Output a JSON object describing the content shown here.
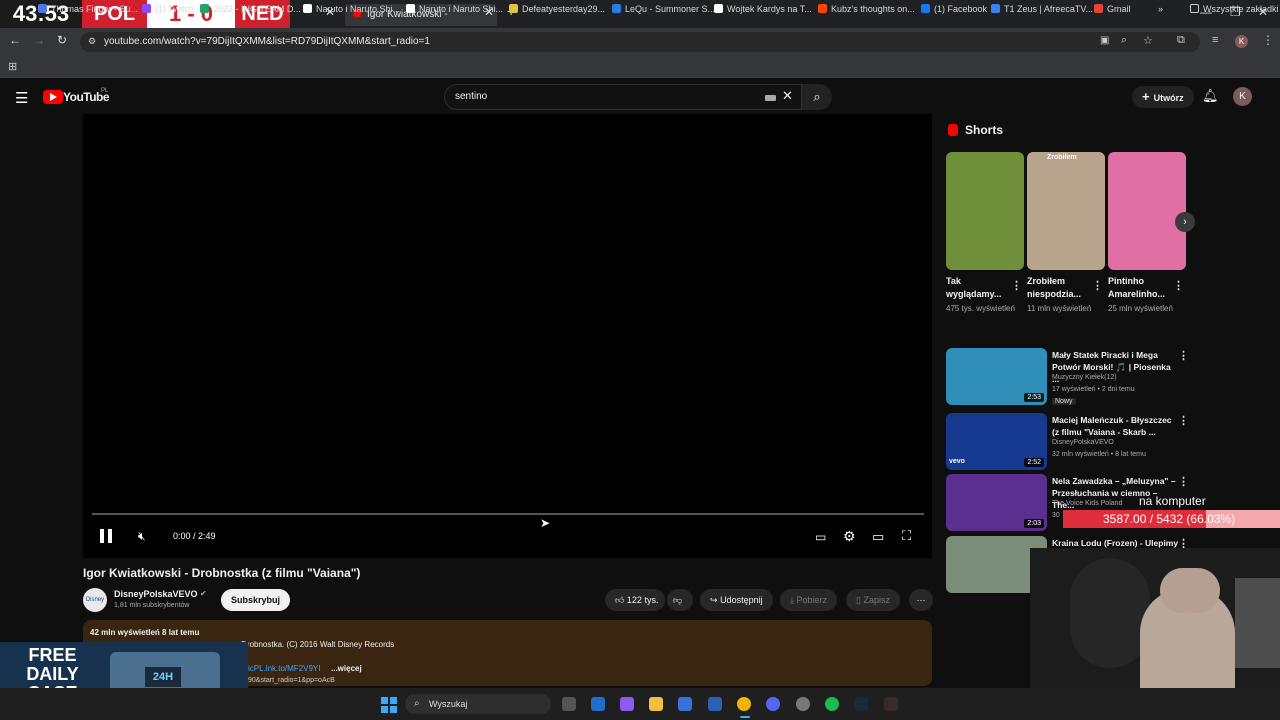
{
  "scoreboard": {
    "time": "43:53",
    "team1": "POL",
    "score": "1 - 0",
    "team2": "NED"
  },
  "tabs": [
    {
      "label": "Igor Kwiatkowski - Drobnostka"
    }
  ],
  "address": {
    "url": "youtube.com/watch?v=79DijItQXMM&list=RD79DijItQXMM&start_radio=1"
  },
  "bookmarks": [
    {
      "label": "Thomas Finger - Su...",
      "color": "#4a7be0"
    },
    {
      "label": "(1) Twitch",
      "color": "#9146ff"
    },
    {
      "label": "2022 - IHG TEAM D...",
      "color": "#1fa463"
    },
    {
      "label": "Naruto i Naruto Shi...",
      "color": "#ffffff"
    },
    {
      "label": "Naruto i Naruto Shi...",
      "color": "#ffffff"
    },
    {
      "label": "Defeatyesterday29...",
      "color": "#e0c341"
    },
    {
      "label": "LeQu - Summoner S...",
      "color": "#2b7be6"
    },
    {
      "label": "Wojtek Kardys na T...",
      "color": "#ffffff"
    },
    {
      "label": "Kubz's thoughts on...",
      "color": "#ff4500"
    },
    {
      "label": "(1) Facebook",
      "color": "#1877f2"
    },
    {
      "label": "T1 Zeus | AfreecaTV...",
      "color": "#3b82f6"
    },
    {
      "label": "Gmail",
      "color": "#ea4335"
    }
  ],
  "bookmarks_all": "Wszystkie zakładki",
  "yt": {
    "logo": "YouTube",
    "region": "PL",
    "search_value": "sentino",
    "create": "Utwórz",
    "avatar": "K"
  },
  "player": {
    "time": "0:00 / 2:49"
  },
  "video": {
    "title": "Igor Kwiatkowski - Drobnostka (z filmu \"Vaiana\")",
    "channel": "DisneyPolskaVEVO",
    "subs": "1,81 mln subskrybentów",
    "subscribe": "Subskrybuj",
    "likes": "122 tys.",
    "share": "Udostępnij",
    "download": "Pobierz",
    "save": "Zapisz",
    "views_line": "42 mln wyświetleń  8 lat temu",
    "desc_line": "ng Drobnostka. (C) 2016 Walt Disney Records",
    "desc_link": "icPL.lnk.to/MF2V9YI",
    "more": "...więcej",
    "desc_line3": "90&start_radio=1&pp=oAcB"
  },
  "shorts": {
    "header": "Shorts",
    "items": [
      {
        "title": "Tak wyglądamy...",
        "views": "475 tys. wyświetleń",
        "color": "#6f8f3a"
      },
      {
        "title": "Zrobiłem niespodzia...",
        "views": "11 mln wyświetleń",
        "color": "#b9a58e",
        "overlay": "Zrobiłem"
      },
      {
        "title": "Pintinho Amarelinho...",
        "views": "25 mln wyświetleń",
        "color": "#e06fa6"
      }
    ]
  },
  "recs": [
    {
      "title": "Mały Statek Piracki i Mega Potwór Morski! 🎵 | Piosenka ...",
      "channel": "Muzyczny Kiełek(12)",
      "meta": "17 wyświetleń • 2 dni temu",
      "badge": "Nowy",
      "dur": "2:53",
      "color": "#2f8fb8"
    },
    {
      "title": "Maciej Maleńczuk - Błyszczec (z filmu \"Vaiana - Skarb ...",
      "channel": "DisneyPolskaVEVO",
      "meta": "32 mln wyświetleń • 8 lat temu",
      "dur": "2:52",
      "color": "#153a8f",
      "brand": "vevo"
    },
    {
      "title": "Nela Zawadzka – „Meluzyna\" – Przesłuchania w ciemno – The...",
      "channel": "The Voice Kids Poland",
      "meta": "30",
      "dur": "2:03",
      "color": "#5a2f8f"
    },
    {
      "title": "Kraina Lodu (Frozen) - Ulepimy",
      "channel": "",
      "meta": "",
      "dur": "",
      "color": "#7a8d7a"
    }
  ],
  "overlay": {
    "label": "na komputer",
    "progress_text": "3587.00 / 5432 (66.03%)",
    "progress": 0.6603
  },
  "promo": {
    "text1": "FREE",
    "text2": "DAILY",
    "text3": "CASE",
    "badge": "24H"
  },
  "taskbar": {
    "search": "Wyszukaj"
  }
}
